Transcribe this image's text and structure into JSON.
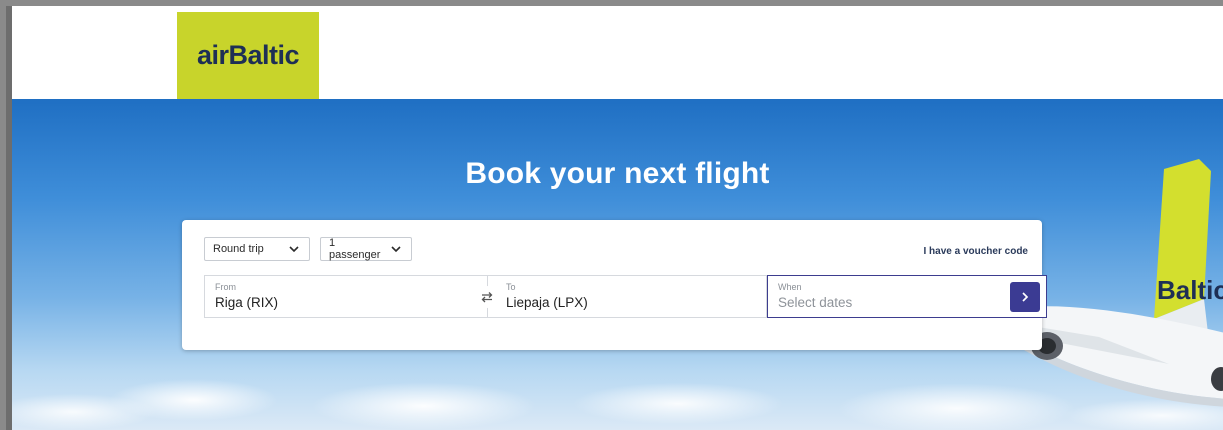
{
  "brand": {
    "logo_text": "airBaltic",
    "accent_color": "#c8d42b",
    "navy": "#3b3b93"
  },
  "hero": {
    "title": "Book your next flight",
    "plane_text": "Baltic"
  },
  "search": {
    "trip_type": {
      "selected": "Round trip"
    },
    "passengers": {
      "selected": "1 passenger"
    },
    "voucher_link": "I have a voucher code",
    "from": {
      "label": "From",
      "value": "Riga (RIX)"
    },
    "to": {
      "label": "To",
      "value": "Liepaja (LPX)"
    },
    "when": {
      "label": "When",
      "placeholder": "Select dates"
    },
    "icons": {
      "swap": "swap-arrows-icon",
      "submit": "chevron-right-icon",
      "dropdown": "chevron-down-icon"
    }
  }
}
